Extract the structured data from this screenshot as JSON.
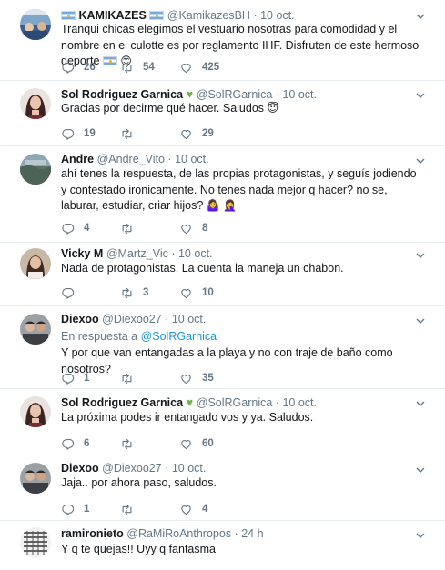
{
  "tweets": [
    {
      "name": "KAMIKAZES",
      "handle": "@KamikazesBH",
      "dot": "·",
      "time": "10 oct.",
      "text": "Tranqui chicas elegimos el vestuario nosotras para comodidad y el nombre en el culotte es por reglamento IHF. Disfruten de este hermoso deporte",
      "replies": "26",
      "retweets": "54",
      "likes": "425"
    },
    {
      "name": "Sol Rodriguez Garnica",
      "handle": "@SolRGarnica",
      "dot": "·",
      "time": "10 oct.",
      "text": "Gracias por decirme qué hacer. Saludos",
      "replies": "19",
      "retweets": "",
      "likes": "29"
    },
    {
      "name": "Andre",
      "handle": "@Andre_Vito",
      "dot": "·",
      "time": "10 oct.",
      "text": "ahí tenes la respuesta, de las propias protagonistas, y seguís jodiendo y contestado ironicamente. No tenes nada mejor q hacer? no se, laburar, estudiar, criar hijos?",
      "replies": "4",
      "retweets": "",
      "likes": "8"
    },
    {
      "name": "Vicky M",
      "handle": "@Martz_Vic",
      "dot": "·",
      "time": "10 oct.",
      "text": "Nada de protagonistas. La cuenta la maneja un chabon.",
      "replies": "",
      "retweets": "3",
      "likes": "10"
    },
    {
      "name": "Diexoo",
      "handle": "@Diexoo27",
      "dot": "·",
      "time": "10 oct.",
      "reply_prefix": "En respuesta a",
      "reply_mention": "@SolRGarnica",
      "text": "Y por que van entangadas a la playa y no con traje de baño como nosotros?",
      "replies": "1",
      "retweets": "",
      "likes": "35"
    },
    {
      "name": "Sol Rodriguez Garnica",
      "handle": "@SolRGarnica",
      "dot": "·",
      "time": "10 oct.",
      "text": "La próxima podes ir entangado vos y ya. Saludos.",
      "replies": "6",
      "retweets": "",
      "likes": "60"
    },
    {
      "name": "Diexoo",
      "handle": "@Diexoo27",
      "dot": "·",
      "time": "10 oct.",
      "text": "Jaja.. por ahora paso, saludos.",
      "replies": "1",
      "retweets": "",
      "likes": "4"
    },
    {
      "name": "ramironieto",
      "handle": "@RaMiRoAnthropos",
      "dot": "·",
      "time": "24 h",
      "text": "Y q te quejas!! Uyy q fantasma"
    }
  ],
  "icons": {
    "reply": "reply-icon",
    "retweet": "retweet-icon",
    "like": "heart-icon",
    "more": "chevron-down-icon",
    "flag": "argentina-flag-icon",
    "verified_heart": "green-heart-icon"
  },
  "colors": {
    "name": "#14171a",
    "secondary": "#657786",
    "link": "#1b95e0",
    "divider": "#e6ecf0",
    "green_heart": "#77b255"
  }
}
